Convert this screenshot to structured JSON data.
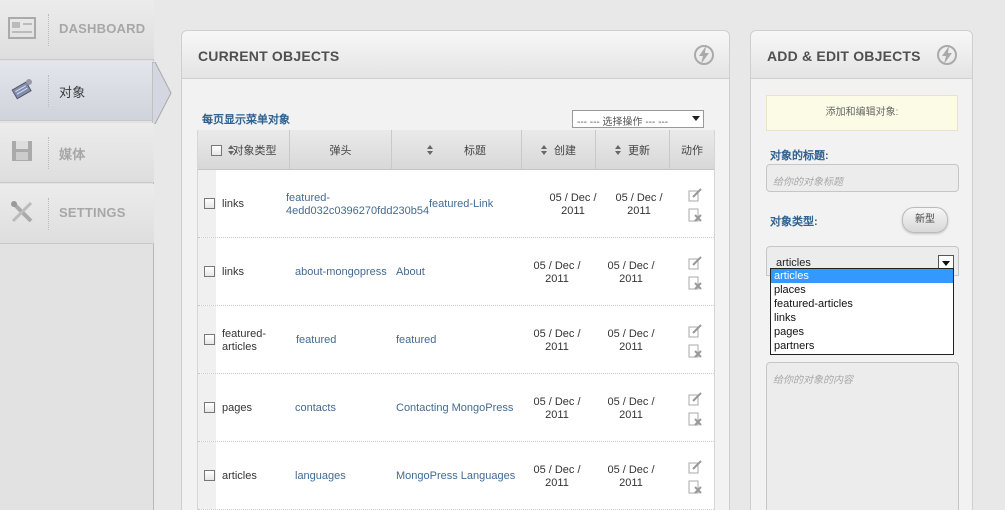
{
  "sidebar": {
    "items": [
      {
        "label": "DASHBOARD",
        "icon": "dashboard-icon",
        "active": false
      },
      {
        "label": "对象",
        "icon": "objects-icon",
        "active": true
      },
      {
        "label": "媒体",
        "icon": "media-icon",
        "active": false
      },
      {
        "label": "SETTINGS",
        "icon": "settings-icon",
        "active": false
      }
    ]
  },
  "current": {
    "title": "CURRENT OBJECTS",
    "per_page_label": "每页显示菜单对象",
    "bulk_action": "--- --- 选择操作 --- ---",
    "columns": {
      "type": "对象类型",
      "slug": "弹头",
      "title": "标题",
      "created": "创建",
      "updated": "更新",
      "actions": "动作"
    },
    "rows": [
      {
        "type": "links",
        "slug": "featured-\n4edd032c0396270fdd230b54",
        "title": "featured-Link",
        "created": "05 / Dec /\n2011",
        "updated": "05 / Dec /\n2011"
      },
      {
        "type": "links",
        "slug": "about-mongopress",
        "title": "About",
        "created": "05 / Dec /\n2011",
        "updated": "05 / Dec /\n2011"
      },
      {
        "type": "featured-\narticles",
        "slug": "featured",
        "title": "featured",
        "created": "05 / Dec /\n2011",
        "updated": "05 / Dec /\n2011"
      },
      {
        "type": "pages",
        "slug": "contacts",
        "title": "Contacting MongoPress",
        "created": "05 / Dec /\n2011",
        "updated": "05 / Dec /\n2011"
      },
      {
        "type": "articles",
        "slug": "languages",
        "title": "MongoPress Languages",
        "created": "05 / Dec /\n2011",
        "updated": "05 / Dec /\n2011"
      }
    ]
  },
  "add": {
    "title": "ADD & EDIT OBJECTS",
    "note": "添加和编辑对象:",
    "title_label": "对象的标题:",
    "title_placeholder": "给你的对象标题",
    "type_label": "对象类型:",
    "new_button": "新型",
    "type_value": "articles",
    "type_options": [
      "articles",
      "places",
      "featured-articles",
      "links",
      "pages",
      "partners"
    ],
    "content_placeholder": "给你的对象的内容"
  }
}
